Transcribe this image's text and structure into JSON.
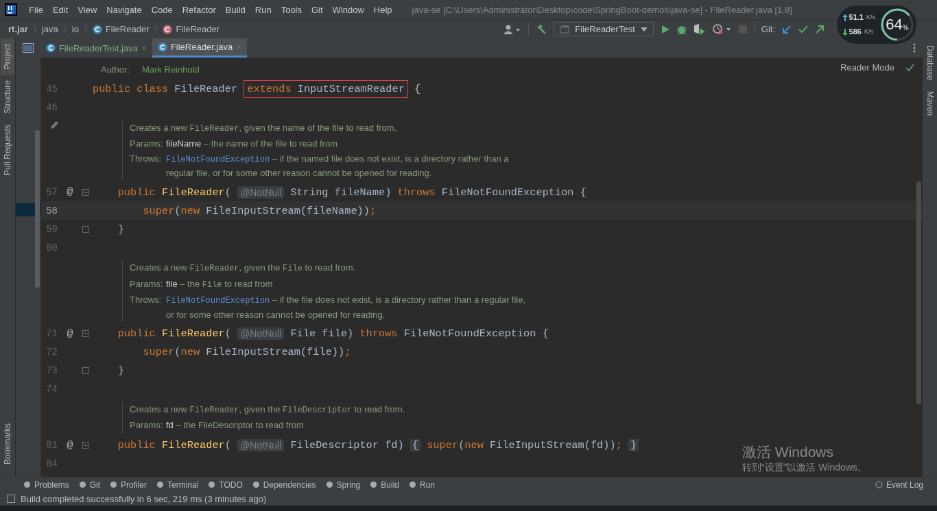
{
  "window": {
    "title": "java-se [C:\\Users\\Administrator\\Desktop\\code\\SpringBoot-demos\\java-se] - FileReader.java [1.8]"
  },
  "menu": [
    "File",
    "Edit",
    "View",
    "Navigate",
    "Code",
    "Refactor",
    "Build",
    "Run",
    "Tools",
    "Git",
    "Window",
    "Help"
  ],
  "breadcrumbs": [
    {
      "label": "rt.jar",
      "kind": "jar"
    },
    {
      "label": "java",
      "kind": "package"
    },
    {
      "label": "io",
      "kind": "package"
    },
    {
      "label": "FileReader",
      "kind": "class"
    },
    {
      "label": "FileReader",
      "kind": "method"
    }
  ],
  "toolbar": {
    "run_config": "FileReaderTest",
    "git_label": "Git:"
  },
  "net_meter": {
    "upload": "51.1",
    "upload_unit": "K/s",
    "download": "586",
    "download_unit": "K/s",
    "percent": "64",
    "percent_sign": "%",
    "level": 0.64
  },
  "left_tools": [
    {
      "label": "Project",
      "selected": true
    },
    {
      "label": "Structure",
      "selected": false
    },
    {
      "label": "Pull Requests",
      "selected": false
    },
    {
      "label": "Bookmarks",
      "selected": false
    }
  ],
  "right_tools": [
    "Database",
    "Maven"
  ],
  "tabs": [
    {
      "label": "FileReaderTest.java",
      "selected": false
    },
    {
      "label": "FileReader.java",
      "selected": true
    }
  ],
  "editor": {
    "reader_mode": "Reader Mode",
    "rows": [
      {
        "kind": "doc_top",
        "edit_icon": false,
        "lines": [
          {
            "kind": "tag",
            "label": "Author:",
            "segments": [
              {
                "kind": "value",
                "text": "Mark Reinhold"
              }
            ]
          }
        ]
      },
      {
        "kind": "code",
        "number": "45",
        "current": false,
        "fold_start": false,
        "fold_end": false,
        "tokens": [
          {
            "kind": "kw",
            "text": "public class "
          },
          {
            "kind": "plain",
            "text": "FileReader "
          },
          {
            "boxed": true,
            "tokens": [
              {
                "kind": "kw",
                "text": "extends "
              },
              {
                "kind": "plain",
                "text": "InputStreamReader"
              }
            ]
          },
          {
            "kind": "plain",
            "text": " {"
          }
        ]
      },
      {
        "kind": "code",
        "number": "46",
        "current": false,
        "fold_start": false,
        "fold_end": false,
        "tokens": []
      },
      {
        "kind": "doc",
        "edit_icon": true,
        "lines": [
          {
            "kind": "summary",
            "segments": [
              {
                "kind": "text",
                "text": "Creates a new "
              },
              {
                "kind": "code",
                "text": "FileReader"
              },
              {
                "kind": "text",
                "text": ", given the name of the file to read from."
              }
            ]
          },
          {
            "kind": "tag",
            "label": "Params:",
            "segments": [
              {
                "kind": "name",
                "text": "fileName"
              },
              {
                "kind": "text",
                "text": " – the name of the file to read from"
              }
            ]
          },
          {
            "kind": "tag",
            "label": "Throws:",
            "segments": [
              {
                "kind": "link",
                "text": "FileNotFoundException"
              },
              {
                "kind": "text",
                "text": " – if the named file does not exist, is a directory rather than a"
              }
            ]
          },
          {
            "kind": "continuation",
            "segments": [
              {
                "kind": "text",
                "text": "regular file, or for some other reason cannot be opened for reading."
              }
            ]
          }
        ]
      },
      {
        "kind": "code",
        "number": "57",
        "current": false,
        "mark": "@",
        "fold_start": true,
        "fold_end": false,
        "tokens": [
          {
            "kind": "kw",
            "text": "    public "
          },
          {
            "kind": "decl",
            "text": "FileReader"
          },
          {
            "kind": "plain",
            "text": "( "
          },
          {
            "kind": "hint",
            "text": "@NotNull"
          },
          {
            "kind": "plain",
            "text": " String fileName) "
          },
          {
            "kind": "kw",
            "text": "throws "
          },
          {
            "kind": "plain",
            "text": "FileNotFoundException {"
          }
        ]
      },
      {
        "kind": "code",
        "number": "58",
        "current": true,
        "fold_start": false,
        "fold_end": false,
        "tokens": [
          {
            "kind": "kw",
            "text": "        super"
          },
          {
            "kind": "plain",
            "text": "("
          },
          {
            "kind": "kw",
            "text": "new "
          },
          {
            "kind": "plain",
            "text": "FileInputStream(fileName))"
          },
          {
            "kind": "kw",
            "text": ";"
          }
        ]
      },
      {
        "kind": "code",
        "number": "59",
        "current": false,
        "fold_start": false,
        "fold_end": true,
        "tokens": [
          {
            "kind": "plain",
            "text": "    }"
          }
        ]
      },
      {
        "kind": "code",
        "number": "60",
        "current": false,
        "fold_start": false,
        "fold_end": false,
        "tokens": []
      },
      {
        "kind": "doc",
        "edit_icon": false,
        "lines": [
          {
            "kind": "summary",
            "segments": [
              {
                "kind": "text",
                "text": "Creates a new "
              },
              {
                "kind": "code",
                "text": "FileReader"
              },
              {
                "kind": "text",
                "text": ", given the "
              },
              {
                "kind": "code",
                "text": "File"
              },
              {
                "kind": "text",
                "text": " to read from."
              }
            ]
          },
          {
            "kind": "tag",
            "label": "Params:",
            "segments": [
              {
                "kind": "name",
                "text": "file"
              },
              {
                "kind": "text",
                "text": " – the "
              },
              {
                "kind": "code",
                "text": "File"
              },
              {
                "kind": "text",
                "text": " to read from"
              }
            ]
          },
          {
            "kind": "tag",
            "label": "Throws:",
            "segments": [
              {
                "kind": "link",
                "text": "FileNotFoundException"
              },
              {
                "kind": "text",
                "text": " – if the file does not exist, is a directory rather than a regular file,"
              }
            ]
          },
          {
            "kind": "continuation",
            "segments": [
              {
                "kind": "text",
                "text": "or for some other reason cannot be opened for reading."
              }
            ]
          }
        ]
      },
      {
        "kind": "code",
        "number": "71",
        "current": false,
        "mark": "@",
        "fold_start": true,
        "fold_end": false,
        "tokens": [
          {
            "kind": "kw",
            "text": "    public "
          },
          {
            "kind": "decl",
            "text": "FileReader"
          },
          {
            "kind": "plain",
            "text": "( "
          },
          {
            "kind": "hint",
            "text": "@NotNull"
          },
          {
            "kind": "plain",
            "text": " File file) "
          },
          {
            "kind": "kw",
            "text": "throws "
          },
          {
            "kind": "plain",
            "text": "FileNotFoundException {"
          }
        ]
      },
      {
        "kind": "code",
        "number": "72",
        "current": false,
        "fold_start": false,
        "fold_end": false,
        "tokens": [
          {
            "kind": "kw",
            "text": "        super"
          },
          {
            "kind": "plain",
            "text": "("
          },
          {
            "kind": "kw",
            "text": "new "
          },
          {
            "kind": "plain",
            "text": "FileInputStream(file))"
          },
          {
            "kind": "kw",
            "text": ";"
          }
        ]
      },
      {
        "kind": "code",
        "number": "73",
        "current": false,
        "fold_start": false,
        "fold_end": true,
        "tokens": [
          {
            "kind": "plain",
            "text": "    }"
          }
        ]
      },
      {
        "kind": "code",
        "number": "74",
        "current": false,
        "fold_start": false,
        "fold_end": false,
        "tokens": []
      },
      {
        "kind": "doc",
        "edit_icon": false,
        "lines": [
          {
            "kind": "summary",
            "segments": [
              {
                "kind": "text",
                "text": "Creates a new "
              },
              {
                "kind": "code",
                "text": "FileReader"
              },
              {
                "kind": "text",
                "text": ", given the "
              },
              {
                "kind": "code",
                "text": "FileDescriptor"
              },
              {
                "kind": "text",
                "text": " to read from."
              }
            ]
          },
          {
            "kind": "tag",
            "label": "Params:",
            "segments": [
              {
                "kind": "name",
                "text": "fd"
              },
              {
                "kind": "text",
                "text": " – the FileDescriptor to read from"
              }
            ]
          }
        ]
      },
      {
        "kind": "code",
        "number": "81",
        "current": false,
        "mark": "@",
        "fold_start": true,
        "fold_end": false,
        "tokens": [
          {
            "kind": "kw",
            "text": "    public "
          },
          {
            "kind": "decl",
            "text": "FileReader"
          },
          {
            "kind": "plain",
            "text": "( "
          },
          {
            "kind": "hint",
            "text": "@NotNull"
          },
          {
            "kind": "plain",
            "text": " FileDescriptor fd) "
          },
          {
            "kind": "folded",
            "text": "{"
          },
          {
            "kind": "kw",
            "text": " super"
          },
          {
            "kind": "plain",
            "text": "("
          },
          {
            "kind": "kw",
            "text": "new "
          },
          {
            "kind": "plain",
            "text": "FileInputStream(fd))"
          },
          {
            "kind": "kw",
            "text": "; "
          },
          {
            "kind": "folded",
            "text": "}"
          }
        ]
      },
      {
        "kind": "code",
        "number": "84",
        "current": false,
        "fold_start": false,
        "fold_end": false,
        "tokens": []
      }
    ]
  },
  "bottom_tools": [
    "Problems",
    "Git",
    "Profiler",
    "Terminal",
    "TODO",
    "Dependencies",
    "Spring",
    "Build",
    "Run"
  ],
  "event_log": "Event Log",
  "status": "Build completed successfully in 6 sec, 219 ms (3 minutes ago)",
  "activation": {
    "title": "激活 Windows",
    "subtitle": "转到“设置”以激活 Windows。"
  }
}
